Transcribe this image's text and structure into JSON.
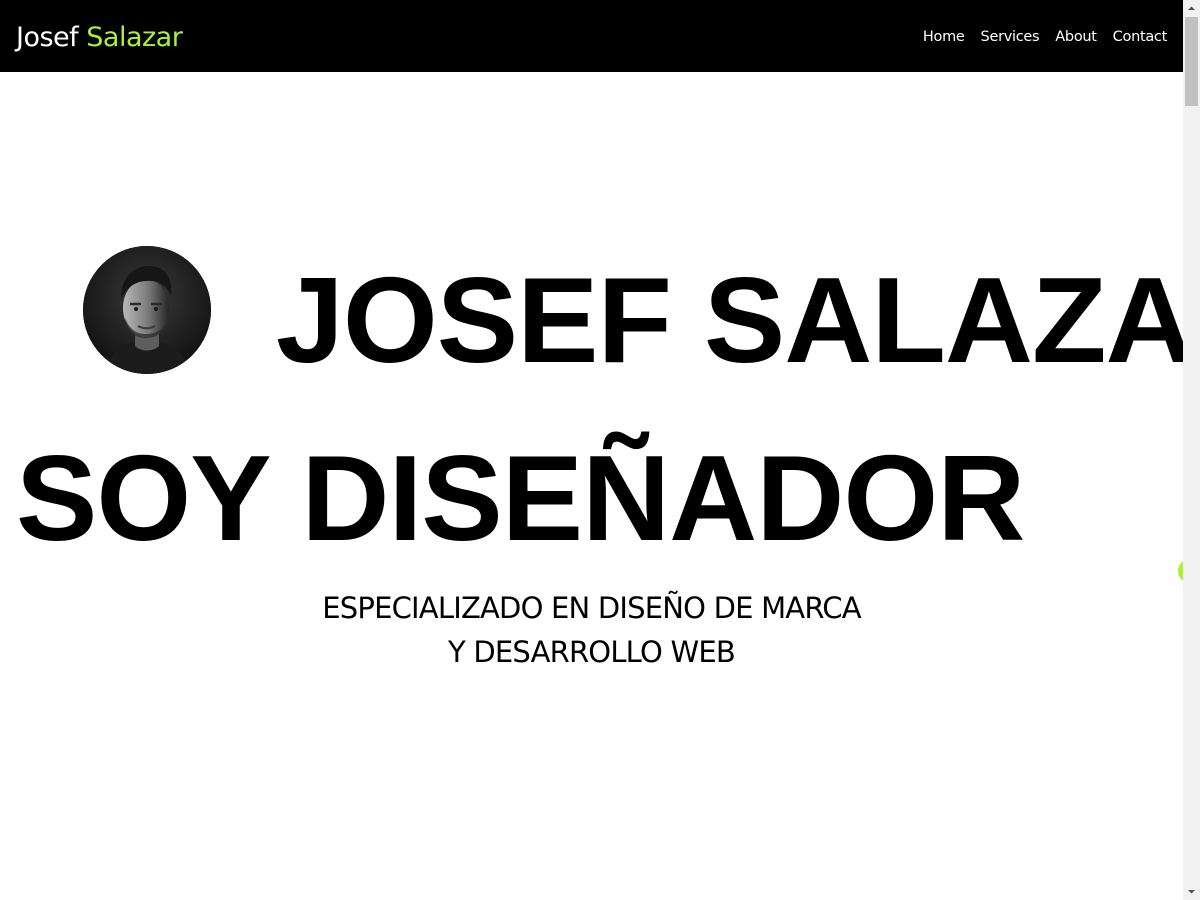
{
  "navbar": {
    "brand_first": "Josef",
    "brand_last": "Salazar",
    "links": [
      {
        "label": "Home"
      },
      {
        "label": "Services"
      },
      {
        "label": "About"
      },
      {
        "label": "Contact"
      }
    ]
  },
  "hero": {
    "avatar_icon": "person-portrait",
    "name": "JOSEF SALAZAR",
    "role": "SOY DISEÑADOR",
    "tagline_line1": "ESPECIALIZADO EN DISEÑO DE MARCA",
    "tagline_line2": "Y DESARROLLO WEB"
  },
  "colors": {
    "navbar_bg": "#000000",
    "accent": "#a8f23a",
    "text": "#000000",
    "background": "#ffffff"
  }
}
